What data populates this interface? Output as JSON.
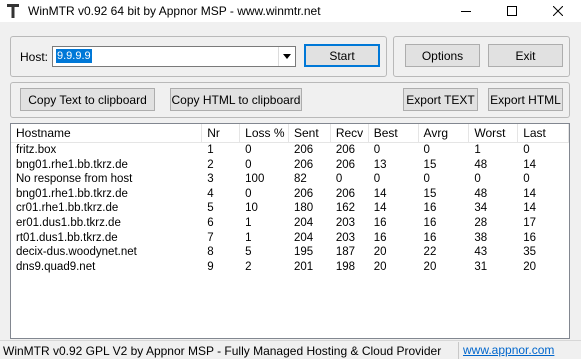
{
  "window": {
    "title": "WinMTR v0.92 64 bit by Appnor MSP - www.winmtr.net",
    "icon": "winmtr-app-icon",
    "controls": [
      "minimize-icon",
      "maximize-icon",
      "close-icon"
    ]
  },
  "host": {
    "label": "Host:",
    "value": "9.9.9.9"
  },
  "buttons": {
    "start": "Start",
    "options": "Options",
    "exit": "Exit",
    "copy_text": "Copy Text to clipboard",
    "copy_html": "Copy HTML to clipboard",
    "export_text": "Export TEXT",
    "export_html": "Export HTML"
  },
  "table": {
    "columns": [
      "Hostname",
      "Nr",
      "Loss %",
      "Sent",
      "Recv",
      "Best",
      "Avrg",
      "Worst",
      "Last"
    ],
    "rows": [
      [
        "fritz.box",
        "1",
        "0",
        "206",
        "206",
        "0",
        "0",
        "1",
        "0"
      ],
      [
        "bng01.rhe1.bb.tkrz.de",
        "2",
        "0",
        "206",
        "206",
        "13",
        "15",
        "48",
        "14"
      ],
      [
        "No response from host",
        "3",
        "100",
        "82",
        "0",
        "0",
        "0",
        "0",
        "0"
      ],
      [
        "bng01.rhe1.bb.tkrz.de",
        "4",
        "0",
        "206",
        "206",
        "14",
        "15",
        "48",
        "14"
      ],
      [
        "cr01.rhe1.bb.tkrz.de",
        "5",
        "10",
        "180",
        "162",
        "14",
        "16",
        "34",
        "14"
      ],
      [
        "er01.dus1.bb.tkrz.de",
        "6",
        "1",
        "204",
        "203",
        "16",
        "16",
        "28",
        "17"
      ],
      [
        "rt01.dus1.bb.tkrz.de",
        "7",
        "1",
        "204",
        "203",
        "16",
        "16",
        "38",
        "16"
      ],
      [
        "decix-dus.woodynet.net",
        "8",
        "5",
        "195",
        "187",
        "20",
        "22",
        "43",
        "35"
      ],
      [
        "dns9.quad9.net",
        "9",
        "2",
        "201",
        "198",
        "20",
        "20",
        "31",
        "20"
      ]
    ]
  },
  "status": {
    "text": "WinMTR v0.92 GPL V2 by Appnor MSP - Fully Managed Hosting & Cloud Provider",
    "link": "www.appnor.com"
  }
}
